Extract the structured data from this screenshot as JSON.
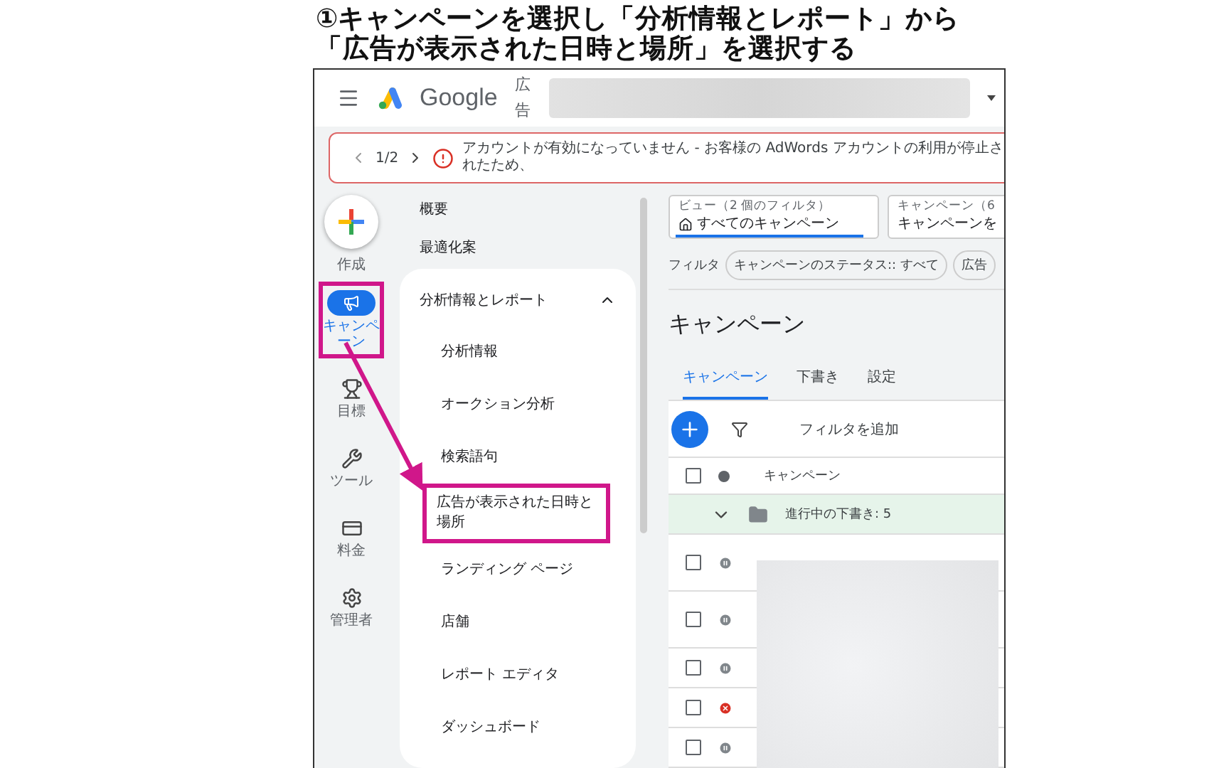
{
  "heading": {
    "lines": [
      "①キャンペーンを選択し「分析情報とレポート」から",
      "「広告が表示された日時と場所」を選択する"
    ]
  },
  "topbar": {
    "logo_text": "Google",
    "product": "広告"
  },
  "alert": {
    "pager": "1/2",
    "message": "アカウントが有効になっていません - お客様の AdWords アカウントの利用が停止されたため、"
  },
  "rail": {
    "create_label": "作成",
    "items": [
      {
        "kind": "campaign",
        "label": "キャンペーン",
        "selected": true,
        "highlighted": true
      },
      {
        "kind": "goals",
        "label": "目標",
        "selected": false,
        "highlighted": false
      },
      {
        "kind": "tools",
        "label": "ツール",
        "selected": false,
        "highlighted": false
      },
      {
        "kind": "billing",
        "label": "料金",
        "selected": false,
        "highlighted": false
      },
      {
        "kind": "admin",
        "label": "管理者",
        "selected": false,
        "highlighted": false
      }
    ]
  },
  "nav": {
    "items": [
      "概要",
      "最適化案"
    ],
    "group": {
      "label": "分析情報とレポート",
      "expanded": true,
      "children": [
        {
          "label": "分析情報",
          "highlighted": false
        },
        {
          "label": "オークション分析",
          "highlighted": false
        },
        {
          "label": "検索語句",
          "highlighted": false
        },
        {
          "label": "広告が表示された日時と場所",
          "highlighted": true
        },
        {
          "label": "ランディング ページ",
          "highlighted": false
        },
        {
          "label": "店舗",
          "highlighted": false
        },
        {
          "label": "レポート エディタ",
          "highlighted": false
        },
        {
          "label": "ダッシュボード",
          "highlighted": false
        }
      ]
    }
  },
  "view_picker": {
    "caption": "ビュー（2 個のフィルタ）",
    "value": "すべてのキャンペーン"
  },
  "campaign_picker": {
    "caption": "キャンペーン（6",
    "value": "キャンペーンを"
  },
  "filters": {
    "label": "フィルタ",
    "chips": [
      "キャンペーンのステータス:: すべて",
      "広告"
    ]
  },
  "title": "キャンペーン",
  "tabs": [
    {
      "label": "キャンペーン",
      "selected": true
    },
    {
      "label": "下書き",
      "selected": false
    },
    {
      "label": "設定",
      "selected": false
    }
  ],
  "toolbar": {
    "add_filter": "フィルタを追加"
  },
  "table": {
    "header": "キャンペーン",
    "header_checked": false,
    "group_row": {
      "label": "進行中の下書き: 5",
      "expanded": true
    },
    "rows": [
      {
        "kind": "paused",
        "checked": false
      },
      {
        "kind": "paused",
        "checked": false
      },
      {
        "kind": "paused",
        "checked": false
      },
      {
        "kind": "removed",
        "checked": false
      },
      {
        "kind": "paused",
        "checked": false
      }
    ]
  }
}
